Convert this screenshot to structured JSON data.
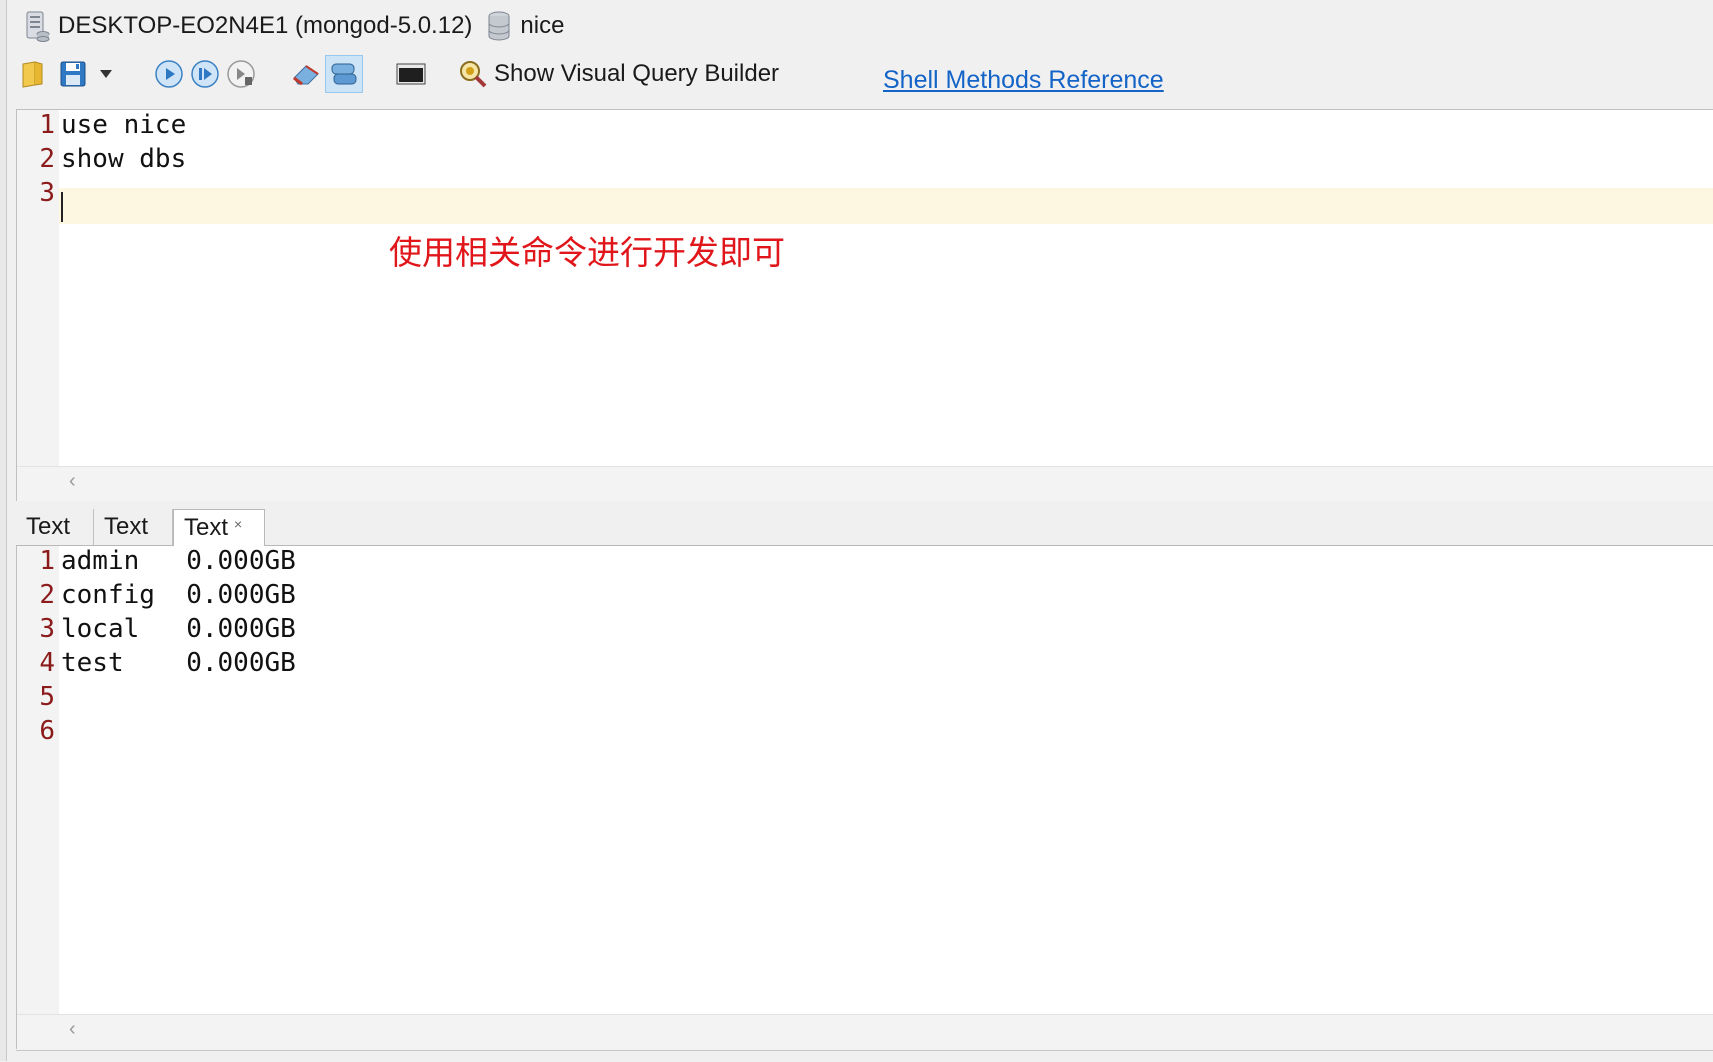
{
  "connection": {
    "host": "DESKTOP-EO2N4E1 (mongod-5.0.12)",
    "database": "nice"
  },
  "toolbar": {
    "icons": [
      "open-folder-icon",
      "save-icon",
      "dropdown-arrow-icon",
      "execute-icon",
      "execute-current-icon",
      "step-execute-icon",
      "eraser-icon",
      "connection-icon",
      "terminal-icon",
      "query-builder-icon"
    ],
    "query_builder_label": "Show Visual Query Builder",
    "shell_reference_link": "Shell Methods Reference"
  },
  "editor": {
    "lines": [
      {
        "number": "1",
        "text": "use nice"
      },
      {
        "number": "2",
        "text": "show dbs"
      },
      {
        "number": "3",
        "text": ""
      }
    ],
    "annotation": "使用相关命令进行开发即可"
  },
  "result_tabs": [
    {
      "label": "Text"
    },
    {
      "label": "Text"
    },
    {
      "label": "Text",
      "close": "×"
    }
  ],
  "output": {
    "lines": [
      {
        "number": "1",
        "text": "admin   0.000GB"
      },
      {
        "number": "2",
        "text": "config  0.000GB"
      },
      {
        "number": "3",
        "text": "local   0.000GB"
      },
      {
        "number": "4",
        "text": "test    0.000GB"
      },
      {
        "number": "5",
        "text": ""
      },
      {
        "number": "6",
        "text": ""
      }
    ]
  },
  "scroll_arrow": "‹",
  "colors": {
    "accent": "#1464c8",
    "line_number": "#8b1a1a",
    "annotation": "#e0161b",
    "current_line": "#fdf7e1"
  }
}
